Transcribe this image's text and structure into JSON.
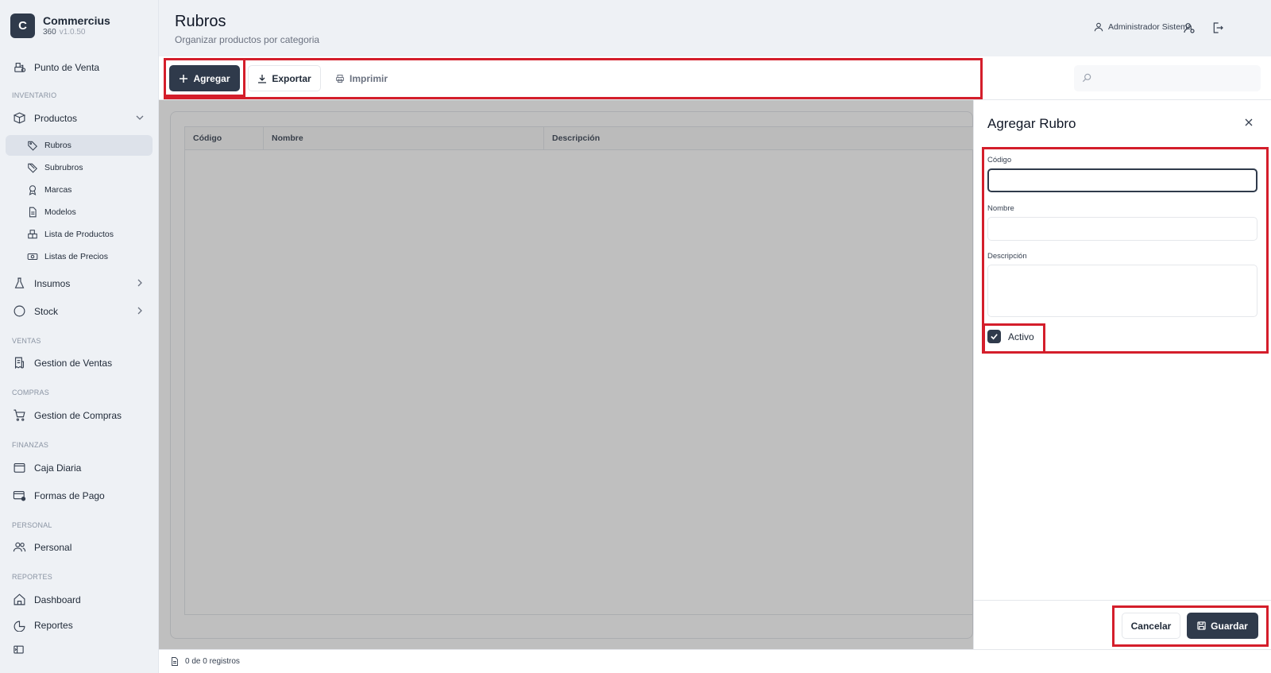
{
  "brand": {
    "initial": "C",
    "name": "Commercius",
    "sub": "360",
    "version": "v1.0.50"
  },
  "sidebar": {
    "pos": "Punto de Venta",
    "sections": {
      "inventario": "INVENTARIO",
      "ventas": "VENTAS",
      "compras": "COMPRAS",
      "finanzas": "FINANZAS",
      "personal": "PERSONAL",
      "reportes": "REPORTES"
    },
    "productos": "Productos",
    "sub": [
      "Rubros",
      "Subrubros",
      "Marcas",
      "Modelos",
      "Lista de Productos",
      "Listas de Precios"
    ],
    "insumos": "Insumos",
    "stock": "Stock",
    "ventas": "Gestion de Ventas",
    "compras": "Gestion de Compras",
    "caja": "Caja Diaria",
    "formas": "Formas de Pago",
    "personal": "Personal",
    "dashboard": "Dashboard",
    "reportes": "Reportes"
  },
  "header": {
    "title": "Rubros",
    "subtitle": "Organizar productos por categoria",
    "user": "Administrador Sistema"
  },
  "toolbar": {
    "add": "Agregar",
    "export": "Exportar",
    "print": "Imprimir",
    "search_placeholder": ""
  },
  "table": {
    "columns": [
      "Código",
      "Nombre",
      "Descripción"
    ],
    "rows": []
  },
  "footer": {
    "count": "0 de 0 registros"
  },
  "drawer": {
    "title": "Agregar Rubro",
    "fields": {
      "codigo": "Código",
      "nombre": "Nombre",
      "descripcion": "Descripción"
    },
    "values": {
      "codigo": "",
      "nombre": "",
      "descripcion": ""
    },
    "activo_label": "Activo",
    "activo": true,
    "cancel": "Cancelar",
    "save": "Guardar"
  },
  "colors": {
    "primary": "#2f3a4b",
    "highlight": "#d41e2b"
  }
}
